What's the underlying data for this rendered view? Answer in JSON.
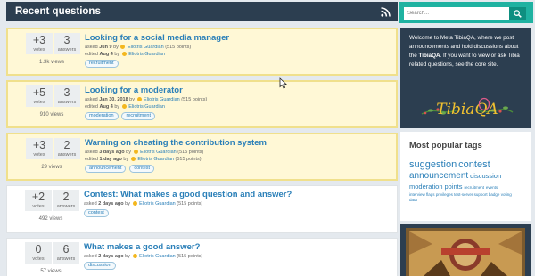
{
  "main": {
    "title": "Recent questions",
    "questions": [
      {
        "votes": "+3",
        "votes_label": "votes",
        "answers": "3",
        "answers_label": "answers",
        "views": "1.3k views",
        "title": "Looking for a social media manager",
        "asked_prefix": "asked",
        "asked_when": "Jun 9",
        "asked_by": "Eliotris Guardian",
        "asked_points": "(515 points)",
        "edited_prefix": "edited",
        "edited_when": "Aug 4",
        "edited_by": "Eliotris Guardian",
        "edited_points": "",
        "tags": [
          "recruitment"
        ],
        "highlighted": true
      },
      {
        "votes": "+5",
        "votes_label": "votes",
        "answers": "3",
        "answers_label": "answers",
        "views": "910 views",
        "title": "Looking for a moderator",
        "asked_prefix": "asked",
        "asked_when": "Jan 30, 2018",
        "asked_by": "Eliotris Guardian",
        "asked_points": "(515 points)",
        "edited_prefix": "edited",
        "edited_when": "Aug 4",
        "edited_by": "Eliotris Guardian",
        "edited_points": "",
        "tags": [
          "moderation",
          "recruitment"
        ],
        "highlighted": true
      },
      {
        "votes": "+3",
        "votes_label": "votes",
        "answers": "2",
        "answers_label": "answers",
        "views": "29 views",
        "title": "Warning on cheating the contribution system",
        "asked_prefix": "asked",
        "asked_when": "3 days ago",
        "asked_by": "Eliotris Guardian",
        "asked_points": "(515 points)",
        "edited_prefix": "edited",
        "edited_when": "1 day ago",
        "edited_by": "Eliotris Guardian",
        "edited_points": "(515 points)",
        "tags": [
          "announcement",
          "contest"
        ],
        "highlighted": true
      },
      {
        "votes": "+2",
        "votes_label": "votes",
        "answers": "2",
        "answers_label": "answers",
        "views": "492 views",
        "title": "Contest: What makes a good question and answer?",
        "asked_prefix": "asked",
        "asked_when": "2 days ago",
        "asked_by": "Eliotris Guardian",
        "asked_points": "(515 points)",
        "tags": [
          "contest"
        ],
        "highlighted": false
      },
      {
        "votes": "0",
        "votes_label": "votes",
        "answers": "6",
        "answers_label": "answers",
        "views": "57 views",
        "title": "What makes a good answer?",
        "asked_prefix": "asked",
        "asked_when": "2 days ago",
        "asked_by": "Eliotris Guardian",
        "asked_points": "(515 points)",
        "tags": [
          "discussion"
        ],
        "highlighted": false
      }
    ]
  },
  "sidebar": {
    "search_placeholder": "Search...",
    "welcome": {
      "text_before": "Welcome to Meta TibiaQA, where we post announcements and hold discussions about the ",
      "site_name": "TibiaQA",
      "text_after": ". If you want to view or ask Tibia related questions, see the core site."
    },
    "logo_text": "TibiaQA",
    "popular_title": "Most popular tags",
    "tag_cloud": {
      "row1": [
        "suggestion",
        "contest"
      ],
      "row2": [
        "announcement",
        "discussion"
      ],
      "row3": [
        "moderation",
        "points",
        "recruitment",
        "events"
      ],
      "row4": [
        "interview",
        "flags",
        "privileges",
        "test-server",
        "support",
        "badge",
        "voting"
      ],
      "row5": [
        "data"
      ]
    }
  },
  "colors": {
    "header": "#2c3e50",
    "accent": "#1fb2a1",
    "link": "#2a7fb8",
    "highlight_bg": "#fff8d6",
    "highlight_border": "#f0e08c"
  }
}
